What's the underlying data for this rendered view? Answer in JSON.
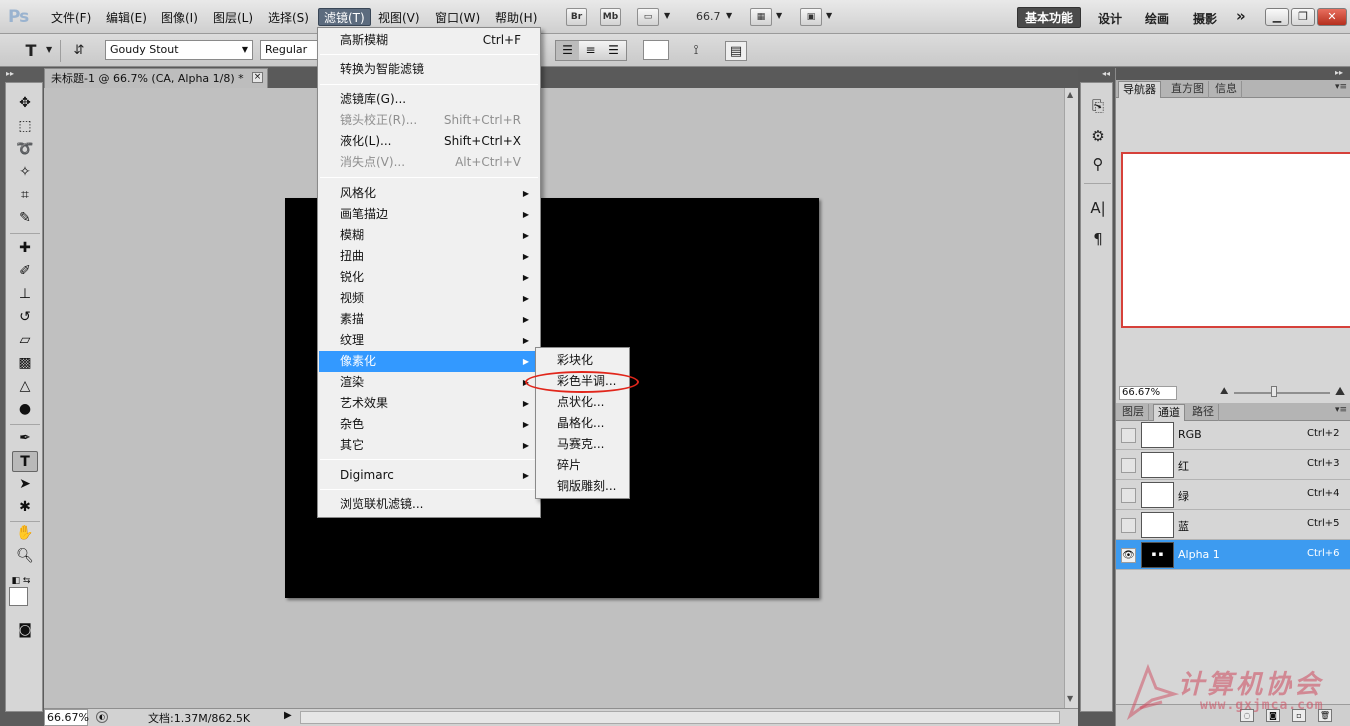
{
  "app": {
    "logo": "Ps"
  },
  "menubar": {
    "items": [
      {
        "label": "文件(F)"
      },
      {
        "label": "编辑(E)"
      },
      {
        "label": "图像(I)"
      },
      {
        "label": "图层(L)"
      },
      {
        "label": "选择(S)"
      },
      {
        "label": "滤镜(T)"
      },
      {
        "label": "视图(V)"
      },
      {
        "label": "窗口(W)"
      },
      {
        "label": "帮助(H)"
      }
    ],
    "bridge_label": "Br",
    "minibridge_label": "Mb",
    "zoom_value": "66.7",
    "workspaces": {
      "active": "基本功能",
      "design": "设计",
      "painting": "绘画",
      "photography": "摄影",
      "more": "»"
    },
    "window_controls": {
      "minimize": "▁",
      "restore": "❐",
      "close": "✕"
    }
  },
  "options": {
    "font_family": "Goudy Stout",
    "font_style": "Regular"
  },
  "document": {
    "tab_title": "未标题-1 @ 66.7% (CA, Alpha 1/8) *",
    "tab_close": "×",
    "canvas_color": "#000000"
  },
  "statusbar": {
    "zoom": "66.67%",
    "doc_info": "文档:1.37M/862.5K",
    "arrow": "▶"
  },
  "filter_menu": {
    "last_filter": {
      "label": "高斯模糊",
      "shortcut": "Ctrl+F"
    },
    "smart_filters": "转换为智能滤镜",
    "gallery": "滤镜库(G)...",
    "lens_correction": {
      "label": "镜头校正(R)...",
      "shortcut": "Shift+Ctrl+R"
    },
    "liquify": {
      "label": "液化(L)...",
      "shortcut": "Shift+Ctrl+X"
    },
    "vanishing_point": {
      "label": "消失点(V)...",
      "shortcut": "Alt+Ctrl+V"
    },
    "submenus": [
      "风格化",
      "画笔描边",
      "模糊",
      "扭曲",
      "锐化",
      "视频",
      "素描",
      "纹理",
      "像素化",
      "渲染",
      "艺术效果",
      "杂色",
      "其它"
    ],
    "digimarc": "Digimarc",
    "browse_online": "浏览联机滤镜...",
    "highlighted": "像素化"
  },
  "pixelate_menu": {
    "items": [
      "彩块化",
      "彩色半调...",
      "点状化...",
      "晶格化...",
      "马赛克...",
      "碎片",
      "铜版雕刻..."
    ],
    "circled": "彩色半调...",
    "circle_color": "#e1261b"
  },
  "navigator": {
    "tabs": [
      "导航器",
      "直方图",
      "信息"
    ],
    "zoom": "66.67%",
    "view_box_color": "#d6413a"
  },
  "channels": {
    "tabs": [
      "图层",
      "通道",
      "路径"
    ],
    "rows": [
      {
        "name": "RGB",
        "shortcut": "Ctrl+2"
      },
      {
        "name": "红",
        "shortcut": "Ctrl+3"
      },
      {
        "name": "绿",
        "shortcut": "Ctrl+4"
      },
      {
        "name": "蓝",
        "shortcut": "Ctrl+5"
      },
      {
        "name": "Alpha 1",
        "shortcut": "Ctrl+6"
      }
    ],
    "selected": "Alpha 1",
    "selection_color": "#3d9bf0"
  },
  "watermark": {
    "text": "计算机协会",
    "url": "www.gxjmca.com"
  },
  "colors": {
    "menu_highlight": "#3399ff",
    "workspace_active_bg": "#4b4b4b",
    "canvas_bg": "#c0c0c0"
  }
}
